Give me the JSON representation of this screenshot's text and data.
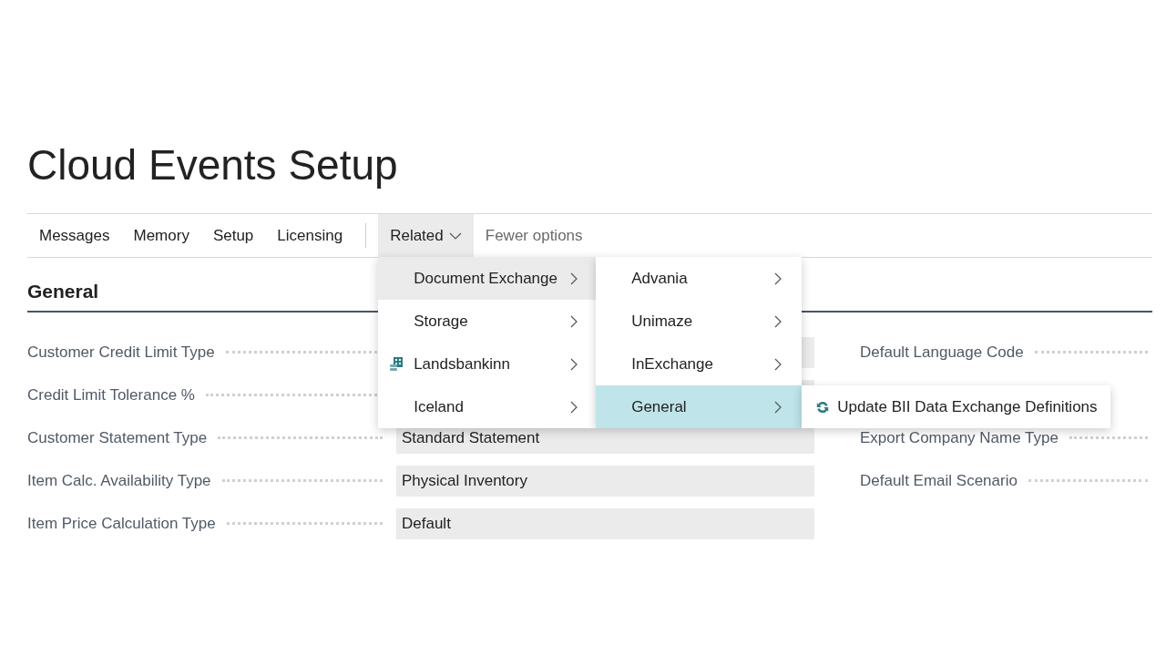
{
  "page": {
    "title": "Cloud Events Setup"
  },
  "action_bar": {
    "actions": [
      {
        "label": "Messages"
      },
      {
        "label": "Memory"
      },
      {
        "label": "Setup"
      },
      {
        "label": "Licensing"
      }
    ],
    "related": {
      "label": "Related",
      "expanded": true
    },
    "fewer_options": "Fewer options"
  },
  "section": {
    "title": "General",
    "rows": [
      {
        "left": {
          "label": "Customer Credit Limit Type"
        },
        "right": {
          "label": "Default Language Code"
        }
      },
      {
        "left": {
          "label": "Credit Limit Tolerance %"
        }
      },
      {
        "left": {
          "label": "Customer Statement Type",
          "value": "Standard Statement"
        },
        "right": {
          "label": "Export Company Name Type"
        }
      },
      {
        "left": {
          "label": "Item Calc. Availability Type",
          "value": "Physical Inventory"
        },
        "right": {
          "label": "Default Email Scenario"
        }
      },
      {
        "left": {
          "label": "Item Price Calculation Type",
          "value": "Default"
        }
      }
    ]
  },
  "menus": [
    {
      "items": [
        {
          "label": "Document Exchange",
          "kind": "submenu",
          "has_icon": false,
          "selected": true
        },
        {
          "label": "Storage",
          "kind": "submenu",
          "has_icon": false,
          "selected": false
        },
        {
          "label": "Landsbankinn",
          "kind": "submenu",
          "has_icon": true,
          "selected": false
        },
        {
          "label": "Iceland",
          "kind": "submenu",
          "has_icon": false,
          "selected": false
        }
      ]
    },
    {
      "items": [
        {
          "label": "Advania",
          "kind": "submenu",
          "has_icon": false,
          "selected": false
        },
        {
          "label": "Unimaze",
          "kind": "submenu",
          "has_icon": false,
          "selected": false
        },
        {
          "label": "InExchange",
          "kind": "submenu",
          "has_icon": false,
          "selected": false
        },
        {
          "label": "General",
          "kind": "submenu",
          "has_icon": false,
          "selected": true
        }
      ]
    },
    {
      "items": [
        {
          "label": "Update BII Data Exchange Definitions",
          "kind": "action",
          "has_icon": true,
          "selected": false
        }
      ]
    }
  ]
}
